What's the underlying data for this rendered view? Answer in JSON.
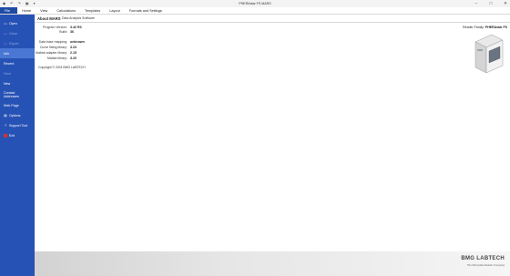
{
  "window": {
    "title": "PHERAstar FS MARS",
    "quick_access": [
      "◆",
      "↶",
      "↷",
      "▣",
      "▾"
    ],
    "controls": [
      "–",
      "□",
      "✕"
    ]
  },
  "ribbon": {
    "tabs": [
      "File",
      "Home",
      "View",
      "Calculations",
      "Templates",
      "Layout",
      "Formats and Settings"
    ]
  },
  "nav": {
    "items": [
      {
        "icon": "▭",
        "label": "Open"
      },
      {
        "icon": "▭",
        "label": "Close"
      },
      {
        "icon": "▭",
        "label": "Export"
      },
      {
        "icon": "",
        "label": "Info"
      },
      {
        "icon": "",
        "label": "Recent"
      },
      {
        "icon": "",
        "label": "Save"
      },
      {
        "icon": "",
        "label": "New"
      },
      {
        "icon": "",
        "label": "Contact Addresses"
      },
      {
        "icon": "",
        "label": "Web Page"
      },
      {
        "icon": "▤",
        "label": "Options"
      },
      {
        "icon": "?",
        "label": "Support Tool"
      },
      {
        "icon": "",
        "label": "Exit"
      }
    ]
  },
  "about": {
    "title": "About MARS",
    "subtitle": "Data Analysis Software",
    "fields": [
      {
        "label": "Program Version:",
        "value": "3.42 R3"
      },
      {
        "label": "Build:",
        "value": "36"
      },
      {
        "label": "Data base mapping:",
        "value": "unknown"
      },
      {
        "label": "Curve fitting library:",
        "value": "3.23"
      },
      {
        "label": "Matlab adapter library:",
        "value": "2.15"
      },
      {
        "label": "Matlab library:",
        "value": "3.20"
      }
    ],
    "copyright": "Copyright © 2024 BMG LABTECH"
  },
  "reader": {
    "label": "Reader Family:",
    "value": "PHERAstar FS"
  },
  "branding": {
    "logo": "BMG LABTECH",
    "tagline": "The Microplate Reader Company"
  },
  "colors": {
    "nav_bg": "#2752b5",
    "nav_selected": "#4a77d4",
    "file_tab": "#1f4aa6",
    "exit_icon": "#d7312b",
    "logo_accent": "#d7312b"
  }
}
